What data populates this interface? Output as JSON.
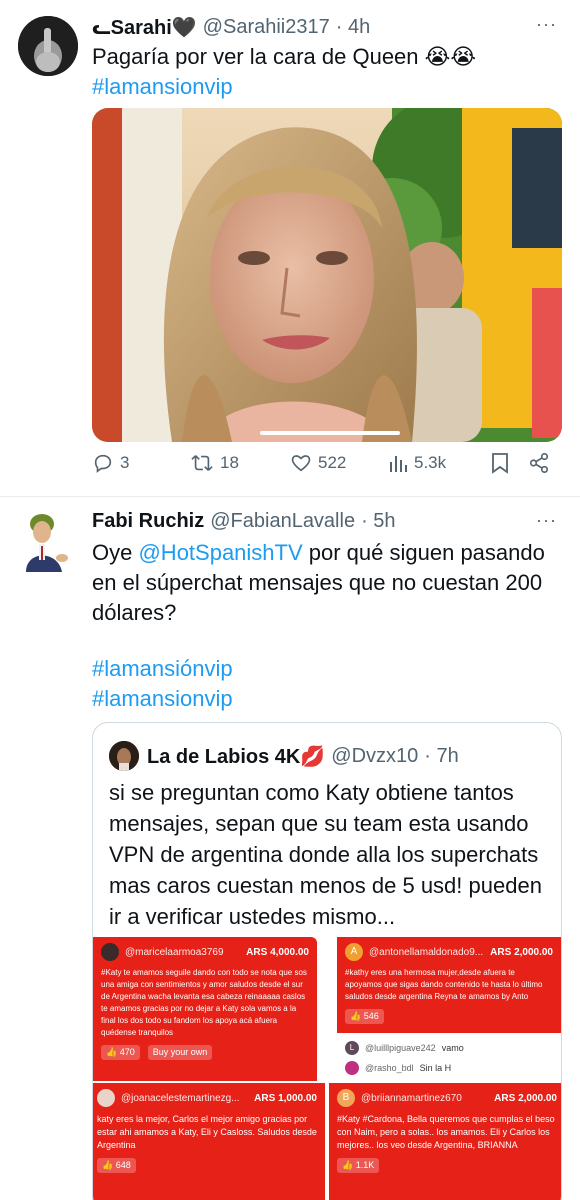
{
  "tweet1": {
    "display_name": "ᓚSarahi🖤",
    "handle": "@Sarahii2317",
    "time": "· 4h",
    "text": "Pagaría por ver la cara de Queen 😭😭",
    "hashtag": "#lamansionvip",
    "actions": {
      "replies": "3",
      "retweets": "18",
      "likes": "522",
      "views": "5.3k"
    }
  },
  "tweet2": {
    "display_name": "Fabi Ruchiz",
    "handle": "@FabianLavalle",
    "time": "· 5h",
    "text_intro": "Oye ",
    "mention": "@HotSpanishTV",
    "text_rest": " por qué siguen pasando en el súperchat mensajes que no cuestan 200 dólares?",
    "hashtag1": "#lamansiónvip",
    "hashtag2": "#lamansionvip",
    "quote": {
      "display_name": "La de Labios 4K💋",
      "handle": "@Dvzx10",
      "time": "· 7h",
      "text": "si se preguntan como Katy obtiene tantos mensajes, sepan que su team esta usando VPN de argentina donde alla los superchats mas caros cuestan menos de 5 usd! pueden ir a verificar ustedes mismo...",
      "superchats": [
        {
          "user": "@maricelaarmoa3769",
          "amount": "ARS 4,000.00",
          "message": "#Katy te amamos seguile dando con todo se nota que sos una amiga con sentimientos y amor saludos desde el sur de Argentina wacha levanta esa cabeza reinaaaaa caslos te amamos gracias por no dejar a Katy sola vamos a la final los dos todo su fandom los apoya acá afuera quédense tranquilos",
          "likes": "470",
          "buy_label": "Buy your own"
        },
        {
          "user": "@antonellamaldonado9...",
          "amount": "ARS 2,000.00",
          "message": "#kathy eres una hermosa mujer,desde afuera te apoyamos que sigas dando contenido te hasta lo último saludos desde argentina Reyna te amamos by Anto",
          "likes": "546",
          "avatar_letter": "A"
        },
        {
          "user": "@joanacelestemartinezg...",
          "amount": "ARS 1,000.00",
          "message": "katy eres la mejor, Carlos el mejor amigo gracias por estar ahi amamos a Katy, Eli y Casloss. Saludos desde Argentina",
          "likes": "648"
        },
        {
          "user": "@briiannamartinez670",
          "amount": "ARS 2,000.00",
          "message": "#Katy #Cardona, Bella queremos que cumplas el beso con Naim, pero a solas.. los amamos. Eli y Carlos los mejores.. los veo desde Argentina, BRIANNA",
          "likes": "1.1K",
          "avatar_letter": "B"
        }
      ],
      "chat_lines": [
        {
          "letter": "L",
          "user": "@luilllpiguave242",
          "msg": "vamo"
        },
        {
          "letter": "",
          "user": "@rasho_bdl",
          "msg": "Sin la H"
        }
      ]
    }
  },
  "colors": {
    "link": "#1d9bf0",
    "secondary_text": "#536471",
    "superchat_red": "#e62117"
  },
  "icons": [
    "reply-icon",
    "retweet-icon",
    "like-icon",
    "views-icon",
    "bookmark-icon",
    "share-icon",
    "more-icon"
  ]
}
